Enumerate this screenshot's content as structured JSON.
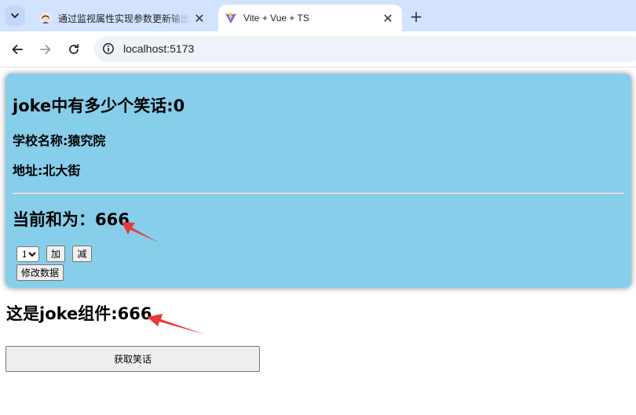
{
  "browser": {
    "tabs": [
      {
        "title": "通过监视属性实现参数更新输出",
        "active": false,
        "close": "✕"
      },
      {
        "title": "Vite + Vue + TS",
        "active": true,
        "close": "✕"
      }
    ],
    "new_tab_symbol": "+",
    "url": "localhost:5173",
    "icons": {
      "tab_search": "chevron-down-icon",
      "back": "back-arrow-icon",
      "forward": "forward-arrow-icon",
      "reload": "reload-icon",
      "site_info": "site-info-icon"
    }
  },
  "app": {
    "card_bg": "#87ceeb",
    "joke_count_heading": "joke中有多少个笑话:0",
    "school_label": "学校名称:猿究院",
    "address_label": "地址:北大街",
    "sum_heading": "当前和为：666",
    "select_value": "1",
    "add_button": "加",
    "subtract_button": "减",
    "modify_button": "修改数据",
    "joke_component_heading": "这是joke组件:666",
    "fetch_joke_button": "获取笑话"
  },
  "annotations": {
    "arrow_color": "#e83a3a"
  }
}
